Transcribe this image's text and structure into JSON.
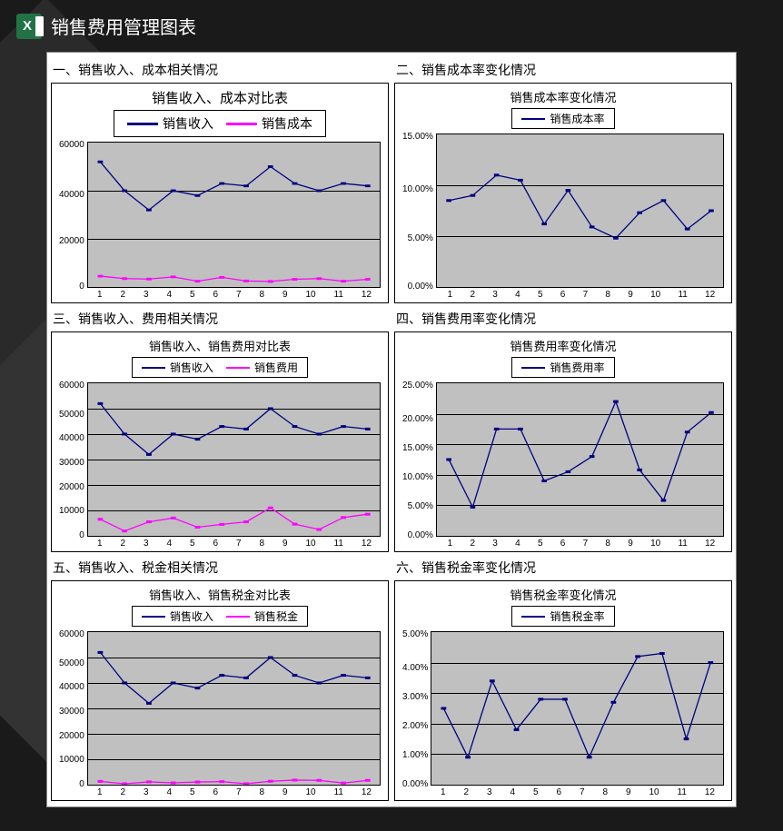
{
  "app_title": "销售费用管理图表",
  "excel_glyph": "X",
  "colors": {
    "blue": "#000080",
    "magenta": "#ff00ff",
    "gridbg": "#c0c0c0"
  },
  "chart_data": [
    {
      "section": "一、销售收入、成本相关情况",
      "title": "销售收入、成本对比表",
      "type": "line",
      "large": true,
      "categories": [
        1,
        2,
        3,
        4,
        5,
        6,
        7,
        8,
        9,
        10,
        11,
        12
      ],
      "ylim": [
        0,
        60000
      ],
      "yticks": [
        "60000",
        "40000",
        "20000",
        "0"
      ],
      "series": [
        {
          "name": "销售收入",
          "color": "blue",
          "values": [
            52000,
            40000,
            32000,
            40000,
            38000,
            43000,
            42000,
            50000,
            43000,
            40000,
            43000,
            42000
          ]
        },
        {
          "name": "销售成本",
          "color": "magenta",
          "values": [
            4500,
            3500,
            3300,
            4200,
            2400,
            4000,
            2500,
            2300,
            3200,
            3500,
            2400,
            3200
          ]
        }
      ]
    },
    {
      "section": "二、销售成本率变化情况",
      "title": "销售成本率变化情况",
      "type": "line",
      "categories": [
        1,
        2,
        3,
        4,
        5,
        6,
        7,
        8,
        9,
        10,
        11,
        12
      ],
      "ylim": [
        0,
        15
      ],
      "yticks": [
        "15.00%",
        "10.00%",
        "5.00%",
        "0.00%"
      ],
      "series": [
        {
          "name": "销售成本率",
          "color": "blue",
          "values": [
            8.5,
            9.0,
            11.0,
            10.5,
            6.2,
            9.5,
            5.9,
            4.8,
            7.3,
            8.5,
            5.7,
            7.5
          ]
        }
      ]
    },
    {
      "section": "三、销售收入、费用相关情况",
      "title": "销售收入、销售费用对比表",
      "type": "line",
      "categories": [
        1,
        2,
        3,
        4,
        5,
        6,
        7,
        8,
        9,
        10,
        11,
        12
      ],
      "ylim": [
        0,
        60000
      ],
      "yticks": [
        "60000",
        "50000",
        "40000",
        "30000",
        "20000",
        "10000",
        "0"
      ],
      "series": [
        {
          "name": "销售收入",
          "color": "blue",
          "values": [
            52000,
            40000,
            32000,
            40000,
            38000,
            43000,
            42000,
            50000,
            43000,
            40000,
            43000,
            42000
          ]
        },
        {
          "name": "销售费用",
          "color": "magenta",
          "values": [
            6500,
            1900,
            5500,
            7000,
            3400,
            4500,
            5500,
            11000,
            4600,
            2500,
            7200,
            8500
          ]
        }
      ]
    },
    {
      "section": "四、销售费用率变化情况",
      "title": "销售费用率变化情况",
      "type": "line",
      "categories": [
        1,
        2,
        3,
        4,
        5,
        6,
        7,
        8,
        9,
        10,
        11,
        12
      ],
      "ylim": [
        0,
        25
      ],
      "yticks": [
        "25.00%",
        "20.00%",
        "15.00%",
        "10.00%",
        "5.00%",
        "0.00%"
      ],
      "series": [
        {
          "name": "销售费用率",
          "color": "blue",
          "values": [
            12.5,
            4.7,
            17.5,
            17.5,
            9.0,
            10.5,
            13.0,
            22.0,
            10.8,
            5.8,
            17.0,
            20.2
          ]
        }
      ]
    },
    {
      "section": "五、销售收入、税金相关情况",
      "title": "销售收入、销售税金对比表",
      "type": "line",
      "categories": [
        1,
        2,
        3,
        4,
        5,
        6,
        7,
        8,
        9,
        10,
        11,
        12
      ],
      "ylim": [
        0,
        60000
      ],
      "yticks": [
        "60000",
        "50000",
        "40000",
        "30000",
        "20000",
        "10000",
        "0"
      ],
      "series": [
        {
          "name": "销售收入",
          "color": "blue",
          "values": [
            52000,
            40000,
            32000,
            40000,
            38000,
            43000,
            42000,
            50000,
            43000,
            40000,
            43000,
            42000
          ]
        },
        {
          "name": "销售税金",
          "color": "magenta",
          "values": [
            1300,
            350,
            1100,
            700,
            1050,
            1200,
            380,
            1350,
            1800,
            1700,
            650,
            1700
          ]
        }
      ]
    },
    {
      "section": "六、销售税金率变化情况",
      "title": "销售税金率变化情况",
      "type": "line",
      "categories": [
        1,
        2,
        3,
        4,
        5,
        6,
        7,
        8,
        9,
        10,
        11,
        12
      ],
      "ylim": [
        0,
        5
      ],
      "yticks": [
        "5.00%",
        "4.00%",
        "3.00%",
        "2.00%",
        "1.00%",
        "0.00%"
      ],
      "series": [
        {
          "name": "销售税金率",
          "color": "blue",
          "values": [
            2.5,
            0.9,
            3.4,
            1.8,
            2.8,
            2.8,
            0.9,
            2.7,
            4.2,
            4.3,
            1.5,
            4.0
          ]
        }
      ]
    }
  ]
}
